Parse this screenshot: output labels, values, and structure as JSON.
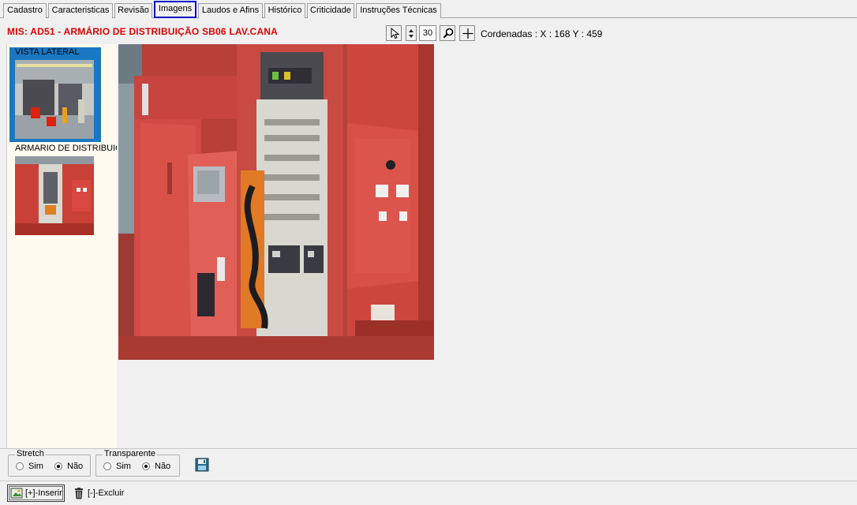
{
  "tabs": [
    {
      "label": "Cadastro"
    },
    {
      "label": "Caracteristicas"
    },
    {
      "label": "Revisão"
    },
    {
      "label": "Imagens",
      "active": true
    },
    {
      "label": "Laudos e Afins"
    },
    {
      "label": "Histórico"
    },
    {
      "label": "Criticidade"
    },
    {
      "label": "Instruções Técnicas"
    }
  ],
  "header": {
    "title": "MIS: AD51 - ARMÁRIO DE DISTRIBUIÇÃO SB06 LAV.CANA",
    "zoom_value": "30",
    "coordinates": "Cordenadas : X : 168   Y : 459"
  },
  "thumbnails": [
    {
      "label": "VISTA LATERAL",
      "selected": true
    },
    {
      "label": "ARMARIO DE DISTRIBUICAO",
      "selected": false
    }
  ],
  "options": {
    "stretch": {
      "legend": "Stretch",
      "yes": "Sim",
      "no": "Não",
      "selected": "Não"
    },
    "transparent": {
      "legend": "Transparente",
      "yes": "Sim",
      "no": "Não",
      "selected": "Não"
    }
  },
  "actions": {
    "insert_label": "[+]-Inserir",
    "delete_label": "[-]-Excluir"
  },
  "colors": {
    "title": "#e00000",
    "active_tab_border": "#1010c8",
    "selection": "#1a78c2",
    "list_background": "#fffaf0"
  }
}
